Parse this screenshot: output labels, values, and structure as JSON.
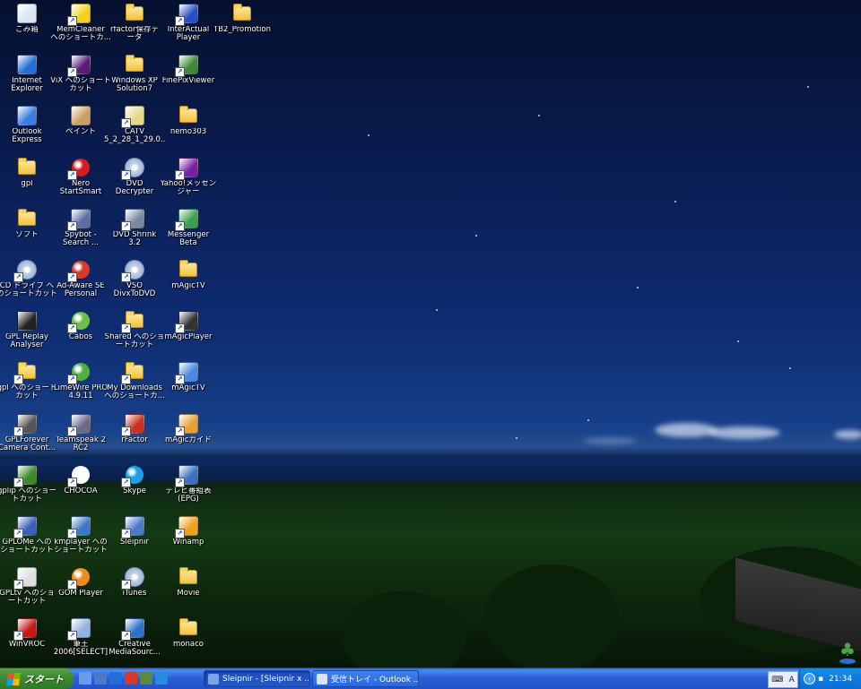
{
  "desktop": {
    "icons": [
      {
        "label": "ごみ箱",
        "icon": "recycle-bin-icon",
        "shortcut": false,
        "color": "#d9e6f2"
      },
      {
        "label": "Internet\nExplorer",
        "icon": "internet-explorer-icon",
        "shortcut": false,
        "color": "#1e6fd9"
      },
      {
        "label": "Outlook\nExpress",
        "icon": "outlook-express-icon",
        "shortcut": false,
        "color": "#3b7de0"
      },
      {
        "label": "gpl",
        "icon": "folder-icon",
        "shortcut": false,
        "color": "#f0c23c"
      },
      {
        "label": "ソフト",
        "icon": "folder-icon",
        "shortcut": false,
        "color": "#f0c23c"
      },
      {
        "label": "CD ドライブ へ\nのショートカット",
        "icon": "cd-drive-icon",
        "shortcut": true,
        "color": "#c7d3e8"
      },
      {
        "label": "GPL Replay\nAnalyser",
        "icon": "gpl-replay-icon",
        "shortcut": false,
        "color": "#222222"
      },
      {
        "label": "gpl へのショート\nカット",
        "icon": "folder-icon",
        "shortcut": true,
        "color": "#f0c23c"
      },
      {
        "label": "GPLForever\nCamera Cont...",
        "icon": "camera-control-icon",
        "shortcut": true,
        "color": "#555555"
      },
      {
        "label": "gplip へのショー\nトカット",
        "icon": "gplip-icon",
        "shortcut": true,
        "color": "#3a8a2a"
      },
      {
        "label": "GPLOMe への\nショートカット",
        "icon": "building-icon",
        "shortcut": true,
        "color": "#3a5fb8"
      },
      {
        "label": "GPLtv へのショ\nートカット",
        "icon": "gpltv-icon",
        "shortcut": true,
        "color": "#dddddd"
      },
      {
        "label": "WinVROC",
        "icon": "winvroc-icon",
        "shortcut": true,
        "color": "#c81818"
      },
      {
        "label": "MemCleaner\nへのショートカ...",
        "icon": "memcleaner-icon",
        "shortcut": true,
        "color": "#f2d21a"
      },
      {
        "label": "ViX へのショート\nカット",
        "icon": "vix-icon",
        "shortcut": true,
        "color": "#5a1a7a"
      },
      {
        "label": "ペイント",
        "icon": "paint-icon",
        "shortcut": false,
        "color": "#c8a060"
      },
      {
        "label": "Nero\nStartSmart",
        "icon": "nero-icon",
        "shortcut": true,
        "color": "#d21e1e"
      },
      {
        "label": "Spybot -\nSearch ...",
        "icon": "spybot-icon",
        "shortcut": true,
        "color": "#5b6ea8"
      },
      {
        "label": "Ad-Aware SE\nPersonal",
        "icon": "ad-aware-icon",
        "shortcut": true,
        "color": "#d83a2a"
      },
      {
        "label": "Cabos",
        "icon": "cabos-icon",
        "shortcut": true,
        "color": "#6cbf4a"
      },
      {
        "label": "LimeWire PRO\n4.9.11",
        "icon": "limewire-icon",
        "shortcut": true,
        "color": "#4db33d"
      },
      {
        "label": "Teamspeak 2\nRC2",
        "icon": "teamspeak-icon",
        "shortcut": true,
        "color": "#6a6a8a"
      },
      {
        "label": "CHOCOA",
        "icon": "chocoa-icon",
        "shortcut": true,
        "color": "#ffffff"
      },
      {
        "label": "kmplayer への\nショートカット",
        "icon": "kmplayer-icon",
        "shortcut": true,
        "color": "#3a78c8"
      },
      {
        "label": "GOM Player",
        "icon": "gom-player-icon",
        "shortcut": true,
        "color": "#f08a1a"
      },
      {
        "label": "筆王\n2006[SELECT]",
        "icon": "fudeoh-icon",
        "shortcut": true,
        "color": "#8fb4e0"
      },
      {
        "label": "rfactor保存デ\nータ",
        "icon": "folder-icon",
        "shortcut": false,
        "color": "#f0c23c"
      },
      {
        "label": "Windows XP\nSolution7",
        "icon": "folder-icon",
        "shortcut": false,
        "color": "#f0c23c"
      },
      {
        "label": "CATV\n5_2_28_1_29.0...",
        "icon": "catv-icon",
        "shortcut": true,
        "color": "#e8d88a"
      },
      {
        "label": "DVD\nDecrypter",
        "icon": "dvd-decrypter-icon",
        "shortcut": true,
        "color": "#c7d3e8"
      },
      {
        "label": "DVD Shrink\n3.2",
        "icon": "dvd-shrink-icon",
        "shortcut": true,
        "color": "#7a8aa0"
      },
      {
        "label": "VSO\nDivxToDVD",
        "icon": "vso-icon",
        "shortcut": true,
        "color": "#c7d3e8"
      },
      {
        "label": "Shared へのショ\nートカット",
        "icon": "folder-icon",
        "shortcut": true,
        "color": "#f0c23c"
      },
      {
        "label": "My Downloads\nへのショートカ...",
        "icon": "folder-icon",
        "shortcut": true,
        "color": "#f0c23c"
      },
      {
        "label": "rFactor",
        "icon": "rfactor-icon",
        "shortcut": true,
        "color": "#c8321e"
      },
      {
        "label": "Skype",
        "icon": "skype-icon",
        "shortcut": true,
        "color": "#1ea0e6"
      },
      {
        "label": "Sleipnir",
        "icon": "sleipnir-icon",
        "shortcut": true,
        "color": "#4a7ac8"
      },
      {
        "label": "iTunes",
        "icon": "itunes-icon",
        "shortcut": true,
        "color": "#2f8f4e"
      },
      {
        "label": "Creative\nMediaSourc...",
        "icon": "creative-mediasource-icon",
        "shortcut": true,
        "color": "#2a72c8"
      },
      {
        "label": "InterActual\nPlayer",
        "icon": "interactual-icon",
        "shortcut": true,
        "color": "#2a50c8"
      },
      {
        "label": "FinePixViewer",
        "icon": "finepix-icon",
        "shortcut": true,
        "color": "#3a8a3a"
      },
      {
        "label": "nemo303",
        "icon": "folder-icon",
        "shortcut": false,
        "color": "#f0c23c"
      },
      {
        "label": "Yahoo!メッセン\nジャー",
        "icon": "yahoo-messenger-icon",
        "shortcut": true,
        "color": "#7a1fa2"
      },
      {
        "label": "Messenger\nBeta",
        "icon": "messenger-icon",
        "shortcut": true,
        "color": "#3aa04a"
      },
      {
        "label": "mAgicTV",
        "icon": "folder-icon",
        "shortcut": false,
        "color": "#f0c23c"
      },
      {
        "label": "mAgicPlayer",
        "icon": "magicplayer-icon",
        "shortcut": true,
        "color": "#333333"
      },
      {
        "label": "mAgicTV",
        "icon": "monitor-icon",
        "shortcut": true,
        "color": "#4a8ae0"
      },
      {
        "label": "mAgicガイド",
        "icon": "book-icon",
        "shortcut": true,
        "color": "#e8a030"
      },
      {
        "label": "テレビ番組表\n(EPG)",
        "icon": "epg-grid-icon",
        "shortcut": true,
        "color": "#3a70c0"
      },
      {
        "label": "Winamp",
        "icon": "winamp-icon",
        "shortcut": true,
        "color": "#f0a020"
      },
      {
        "label": "Movie",
        "icon": "folder-icon",
        "shortcut": false,
        "color": "#f0c23c"
      },
      {
        "label": "monaco",
        "icon": "folder-icon",
        "shortcut": false,
        "color": "#f0c23c"
      },
      {
        "label": "TB2_Promotion",
        "icon": "folder-icon",
        "shortcut": false,
        "color": "#f0c23c"
      }
    ]
  },
  "taskbar": {
    "start_label": "スタート",
    "quick_launch": [
      {
        "icon": "show-desktop-icon",
        "color": "#6a9ae8"
      },
      {
        "icon": "explorer-quicklaunch-icon",
        "color": "#4a7ac8"
      },
      {
        "icon": "ie-quicklaunch-icon",
        "color": "#1e6fd9"
      },
      {
        "icon": "media-quicklaunch-icon",
        "color": "#d83a2a"
      },
      {
        "icon": "app-quicklaunch-icon",
        "color": "#5a8a3a"
      },
      {
        "icon": "messenger-quicklaunch-icon",
        "color": "#2a8ae0"
      }
    ],
    "tasks": [
      {
        "label": "Sleipnir - [Sleipnir x ...",
        "icon": "sleipnir-task-icon",
        "active": true
      },
      {
        "label": "受信トレイ - Outlook ...",
        "icon": "outlook-task-icon",
        "active": false
      }
    ],
    "lang_label": "A",
    "clock": "21:34"
  }
}
